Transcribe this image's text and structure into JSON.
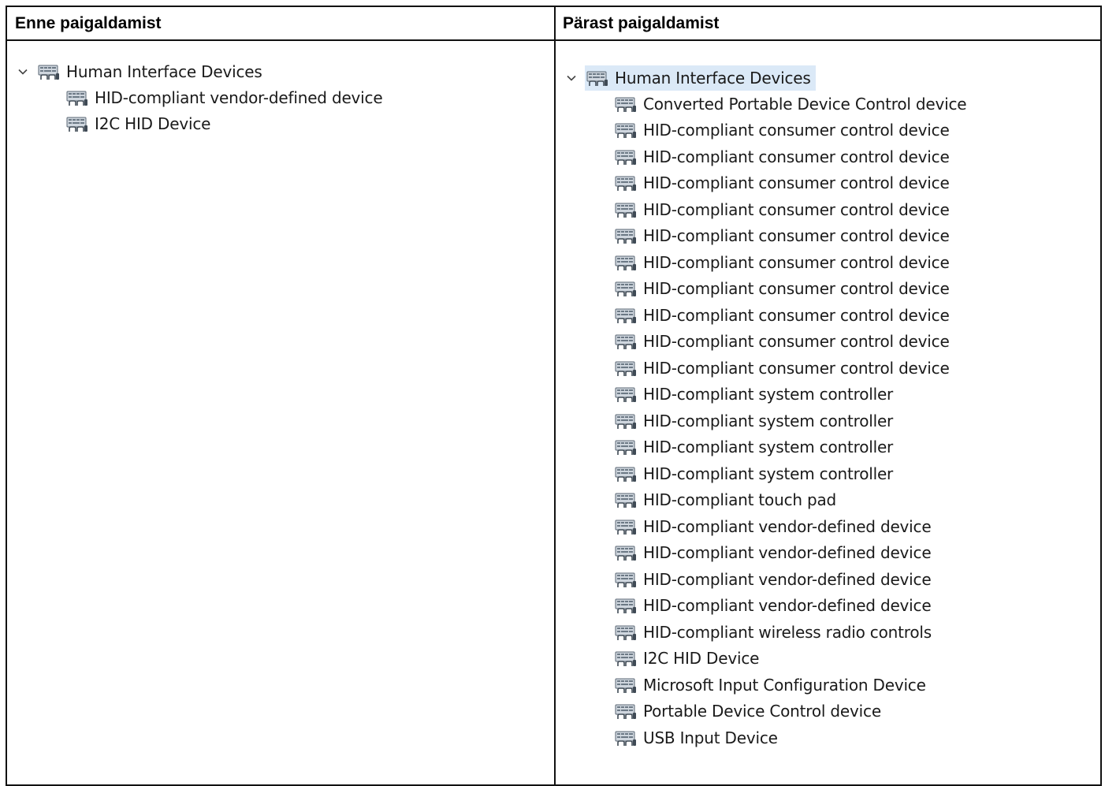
{
  "headers": {
    "before": "Enne paigaldamist",
    "after": "Pärast paigaldamist"
  },
  "before_tree": {
    "root_label": "Human Interface Devices",
    "root_icon": "hid-device-icon",
    "expand_icon": "chevron-down-icon",
    "children": [
      {
        "label": "HID-compliant vendor-defined device"
      },
      {
        "label": "I2C HID Device"
      }
    ]
  },
  "after_tree": {
    "root_label": "Human Interface Devices",
    "root_icon": "hid-device-icon",
    "expand_icon": "chevron-down-icon",
    "selected": true,
    "children": [
      {
        "label": "Converted Portable Device Control device"
      },
      {
        "label": "HID-compliant consumer control device"
      },
      {
        "label": "HID-compliant consumer control device"
      },
      {
        "label": "HID-compliant consumer control device"
      },
      {
        "label": "HID-compliant consumer control device"
      },
      {
        "label": "HID-compliant consumer control device"
      },
      {
        "label": "HID-compliant consumer control device"
      },
      {
        "label": "HID-compliant consumer control device"
      },
      {
        "label": "HID-compliant consumer control device"
      },
      {
        "label": "HID-compliant consumer control device"
      },
      {
        "label": "HID-compliant consumer control device"
      },
      {
        "label": "HID-compliant system controller"
      },
      {
        "label": "HID-compliant system controller"
      },
      {
        "label": "HID-compliant system controller"
      },
      {
        "label": "HID-compliant system controller"
      },
      {
        "label": "HID-compliant touch pad"
      },
      {
        "label": "HID-compliant vendor-defined device"
      },
      {
        "label": "HID-compliant vendor-defined device"
      },
      {
        "label": "HID-compliant vendor-defined device"
      },
      {
        "label": "HID-compliant vendor-defined device"
      },
      {
        "label": "HID-compliant wireless radio controls"
      },
      {
        "label": "I2C HID Device"
      },
      {
        "label": "Microsoft Input Configuration Device"
      },
      {
        "label": "Portable Device Control device"
      },
      {
        "label": "USB Input Device"
      }
    ]
  },
  "colors": {
    "border": "#111111",
    "selection": "#dbe9f7",
    "text": "#1a1a1a"
  }
}
